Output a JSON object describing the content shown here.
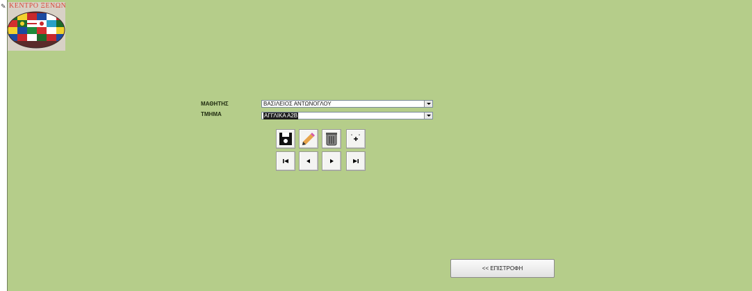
{
  "form": {
    "record_selector_icon": "pencil-edit-icon",
    "logo_text": "ΚΕΝΤΡΟ ΞΕΝΩΝ ΓΛΩΣΣΩΝ",
    "logo_icon": "world-flags-globe-icon"
  },
  "fields": {
    "student_label": "ΜΑΘΗΤΗΣ",
    "student_value": "ΒΑΣΙΛΕΙΟΣ ΑΝΤΩΝΟΓΛΟΥ",
    "class_label": "ΤΜΗΜΑ",
    "class_value": "ΑΓΓΛΙΚΑ Α2Β"
  },
  "toolbar": {
    "icons": [
      "save-floppy-icon",
      "edit-pencil-icon",
      "delete-trash-icon",
      "new-record-icon"
    ],
    "nav_icons": [
      "first-record-icon",
      "previous-record-icon",
      "next-record-icon",
      "last-record-icon"
    ]
  },
  "back_button_label": "<< ΕΠΙΣΤΡΟΦΗ",
  "colors": {
    "background": "#b5cd8a",
    "accent_selected": "#1d1d1d"
  }
}
